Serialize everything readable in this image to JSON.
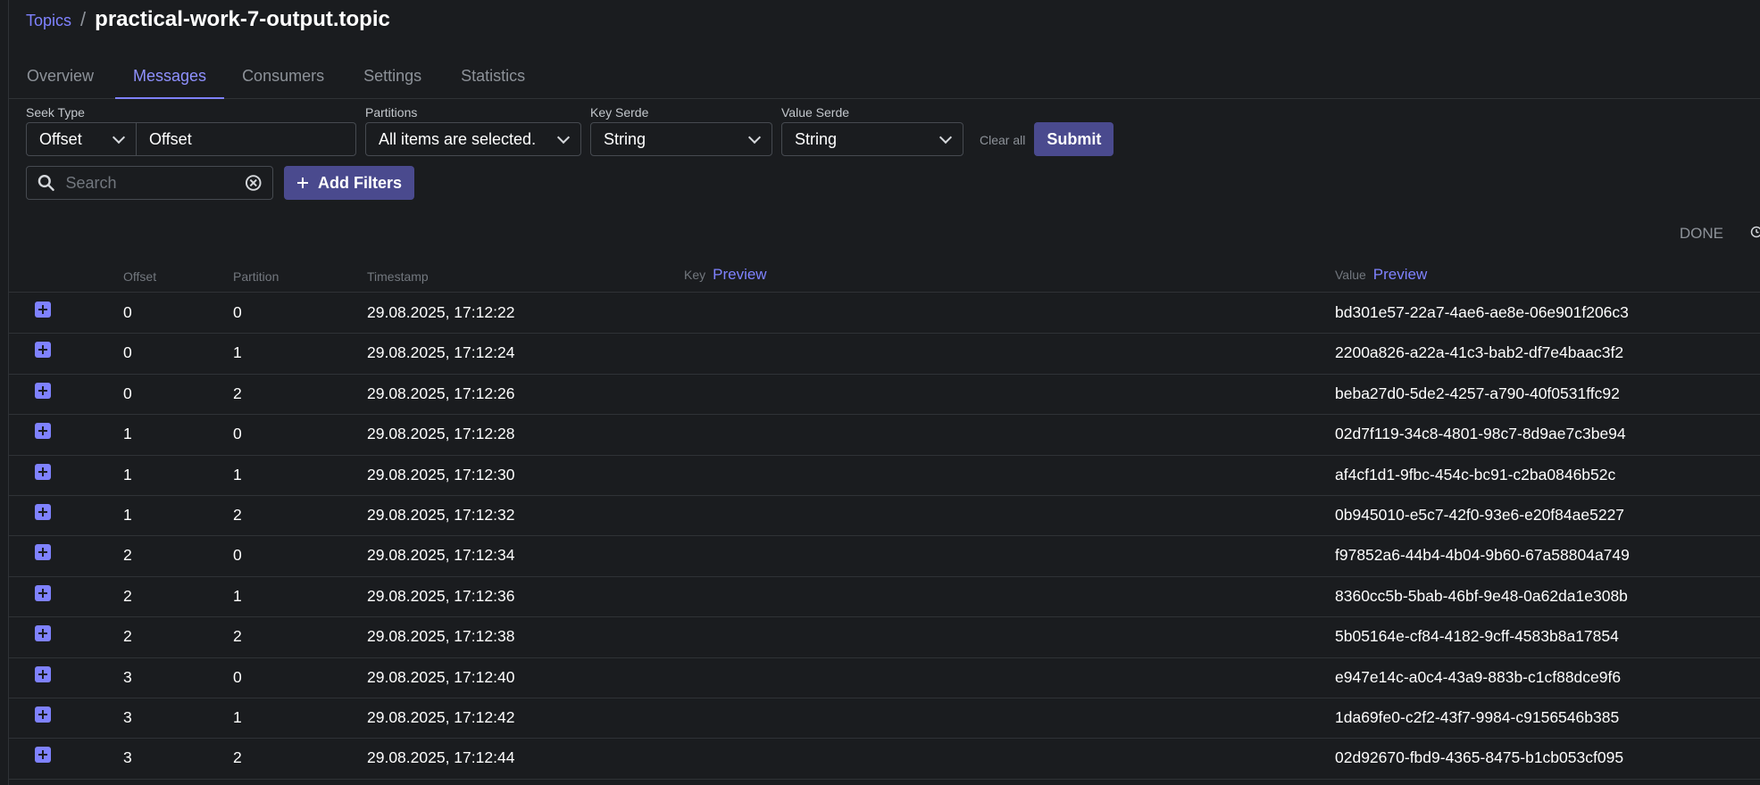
{
  "breadcrumb": {
    "parent": "Topics",
    "separator": "/",
    "title": "practical-work-7-output.topic"
  },
  "tabs": [
    {
      "label": "Overview"
    },
    {
      "label": "Messages"
    },
    {
      "label": "Consumers"
    },
    {
      "label": "Settings"
    },
    {
      "label": "Statistics"
    }
  ],
  "active_tab": "Messages",
  "filters": {
    "seek_type_label": "Seek Type",
    "seek_type_value": "Offset",
    "seek_input_value": "Offset",
    "partitions_label": "Partitions",
    "partitions_value": "All items are selected.",
    "key_serde_label": "Key Serde",
    "key_serde_value": "String",
    "value_serde_label": "Value Serde",
    "value_serde_value": "String",
    "clear_all": "Clear all",
    "submit": "Submit"
  },
  "search": {
    "placeholder": "Search",
    "add_filters": "Add Filters"
  },
  "status": "DONE",
  "table": {
    "headers": {
      "offset": "Offset",
      "partition": "Partition",
      "timestamp": "Timestamp",
      "key": "Key",
      "value": "Value",
      "preview": "Preview"
    },
    "rows": [
      {
        "offset": "0",
        "partition": "0",
        "timestamp": "29.08.2025, 17:12:22",
        "value": "bd301e57-22a7-4ae6-ae8e-06e901f206c3"
      },
      {
        "offset": "0",
        "partition": "1",
        "timestamp": "29.08.2025, 17:12:24",
        "value": "2200a826-a22a-41c3-bab2-df7e4baac3f2"
      },
      {
        "offset": "0",
        "partition": "2",
        "timestamp": "29.08.2025, 17:12:26",
        "value": "beba27d0-5de2-4257-a790-40f0531ffc92"
      },
      {
        "offset": "1",
        "partition": "0",
        "timestamp": "29.08.2025, 17:12:28",
        "value": "02d7f119-34c8-4801-98c7-8d9ae7c3be94"
      },
      {
        "offset": "1",
        "partition": "1",
        "timestamp": "29.08.2025, 17:12:30",
        "value": "af4cf1d1-9fbc-454c-bc91-c2ba0846b52c"
      },
      {
        "offset": "1",
        "partition": "2",
        "timestamp": "29.08.2025, 17:12:32",
        "value": "0b945010-e5c7-42f0-93e6-e20f84ae5227"
      },
      {
        "offset": "2",
        "partition": "0",
        "timestamp": "29.08.2025, 17:12:34",
        "value": "f97852a6-44b4-4b04-9b60-67a58804a749"
      },
      {
        "offset": "2",
        "partition": "1",
        "timestamp": "29.08.2025, 17:12:36",
        "value": "8360cc5b-5bab-46bf-9e48-0a62da1e308b"
      },
      {
        "offset": "2",
        "partition": "2",
        "timestamp": "29.08.2025, 17:12:38",
        "value": "5b05164e-cf84-4182-9cff-4583b8a17854"
      },
      {
        "offset": "3",
        "partition": "0",
        "timestamp": "29.08.2025, 17:12:40",
        "value": "e947e14c-a0c4-43a9-883b-c1cf88dce9f6"
      },
      {
        "offset": "3",
        "partition": "1",
        "timestamp": "29.08.2025, 17:12:42",
        "value": "1da69fe0-c2f2-43f7-9984-c9156546b385"
      },
      {
        "offset": "3",
        "partition": "2",
        "timestamp": "29.08.2025, 17:12:44",
        "value": "02d92670-fbd9-4365-8475-b1cb053cf095"
      }
    ]
  },
  "colors": {
    "background": "#1a1c1f",
    "accent": "#7f82ff",
    "button": "#4a4a8e",
    "border": "#2f3236"
  },
  "icons": {
    "search": "search-icon",
    "clear": "clear-icon",
    "plus": "plus-icon",
    "chevron": "chevron-down-icon",
    "clock": "clock-icon",
    "expand": "expand-icon"
  }
}
